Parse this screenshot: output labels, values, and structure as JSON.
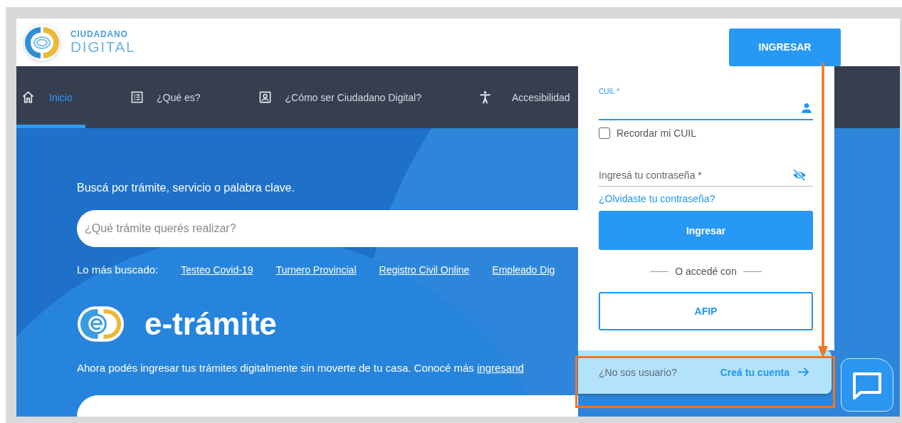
{
  "header": {
    "logo": {
      "line_1": "CIUDADANO",
      "line_2": "DIGITAL"
    },
    "login_button": "INGRESAR"
  },
  "nav": [
    {
      "label": "Inicio",
      "selected": true
    },
    {
      "label": "¿Qué es?",
      "selected": false
    },
    {
      "label": "¿Cómo ser Ciudadano Digital?",
      "selected": false
    },
    {
      "label": "Accesibilidad",
      "selected": false
    }
  ],
  "hero": {
    "prompt": "Buscá por trámite, servicio o palabra clave.",
    "search": {
      "placeholder": "¿Qué trámite querés realizar?"
    },
    "popular_label": "Lo más buscado:",
    "popular_links": [
      "Testeo Covid-19",
      "Turnero Provincial",
      "Registro Civil Online",
      "Empleado Dig"
    ],
    "brand": "e-trámite",
    "description": "Ahora podés ingresar tus trámites digitalmente sin moverte de tu casa. Conocé más ",
    "description_link": "ingresand"
  },
  "login_panel": {
    "cuil_field": {
      "label": "CUIL *"
    },
    "remember": {
      "label": "Recordar mi CUIL",
      "checked": false
    },
    "password_field": {
      "placeholder": "Ingresá tu contraseña *"
    },
    "forgot_link": "¿Olvidaste tu contraseña?",
    "submit_button": "Ingresar",
    "divider_text": "O accedé con",
    "afip_button": "AFIP",
    "footer": {
      "question": "¿No sos usuario?",
      "link": "Creá tu cuenta"
    }
  }
}
